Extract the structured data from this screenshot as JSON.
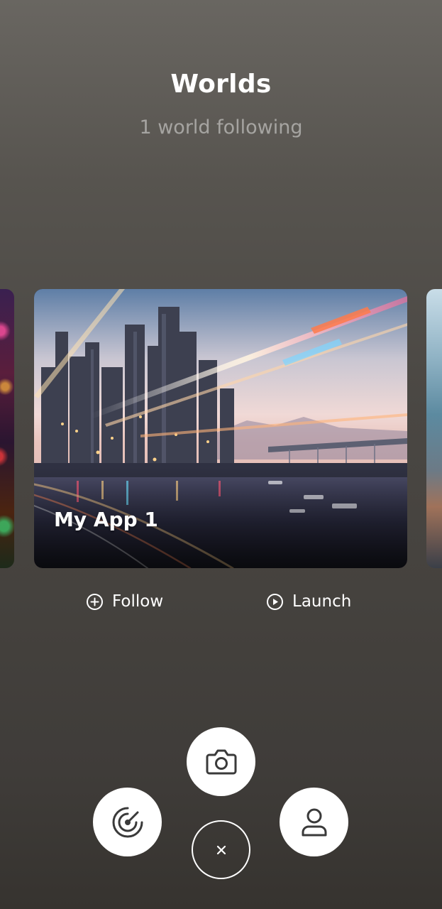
{
  "header": {
    "title": "Worlds",
    "subtitle": "1 world following"
  },
  "carousel": {
    "cards": [
      {
        "label": "My App 1",
        "icon": "city-scene-image"
      }
    ]
  },
  "actions": {
    "follow_label": "Follow",
    "launch_label": "Launch"
  },
  "fab_menu": {
    "camera_icon": "camera-icon",
    "radar_icon": "radar-icon",
    "profile_icon": "profile-icon",
    "close_icon": "close-icon"
  },
  "colors": {
    "background_top": "#696661",
    "background_bottom": "#36332f",
    "fab_background": "#ffffff",
    "icon_color": "#3a3a3a",
    "subtitle_color": "#9a9895"
  }
}
